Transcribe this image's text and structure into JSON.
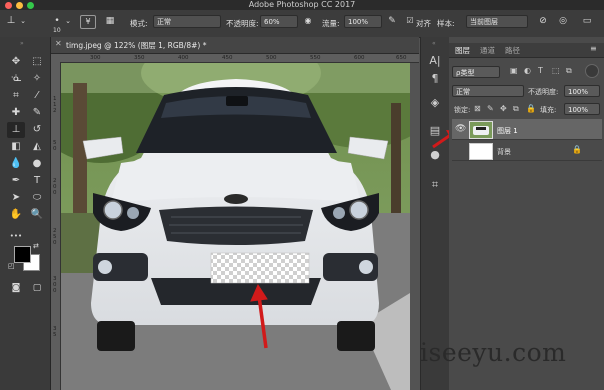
{
  "window": {
    "title": "Adobe Photoshop CC 2017",
    "traffic_colors": [
      "#fc605c",
      "#fdbc40",
      "#34c84a"
    ]
  },
  "options": {
    "brush_size": "10",
    "mode_label": "模式:",
    "mode_value": "正常",
    "opacity_label": "不透明度:",
    "opacity_value": "60%",
    "flow_label": "流量:",
    "flow_value": "100%",
    "align_label": "对齐",
    "sample_label": "样本:",
    "sample_value": "当前图层"
  },
  "document": {
    "tab_title": "timg.jpeg @ 122% (图层 1, RGB/8#) *",
    "ruler_top": [
      "300",
      "350",
      "400",
      "450",
      "500",
      "550",
      "600",
      "650"
    ],
    "ruler_left": [
      "1",
      "1",
      "2",
      "5",
      "0",
      "2",
      "0",
      "0",
      "2",
      "5",
      "0",
      "3",
      "0",
      "0",
      "3",
      "5"
    ]
  },
  "layers_panel": {
    "tabs": [
      "图层",
      "通道",
      "路径"
    ],
    "kind_label": "ρ类型",
    "blend_mode": "正常",
    "opacity_label": "不透明度:",
    "opacity_value": "100%",
    "lock_label": "锁定:",
    "fill_label": "填充:",
    "fill_value": "100%",
    "layers": [
      {
        "name": "图层 1",
        "visible": true,
        "selected": true
      },
      {
        "name": "背景",
        "visible": false,
        "selected": false
      }
    ]
  },
  "watermark": "iseeyu.com",
  "annotation_color": "#d11a1a"
}
